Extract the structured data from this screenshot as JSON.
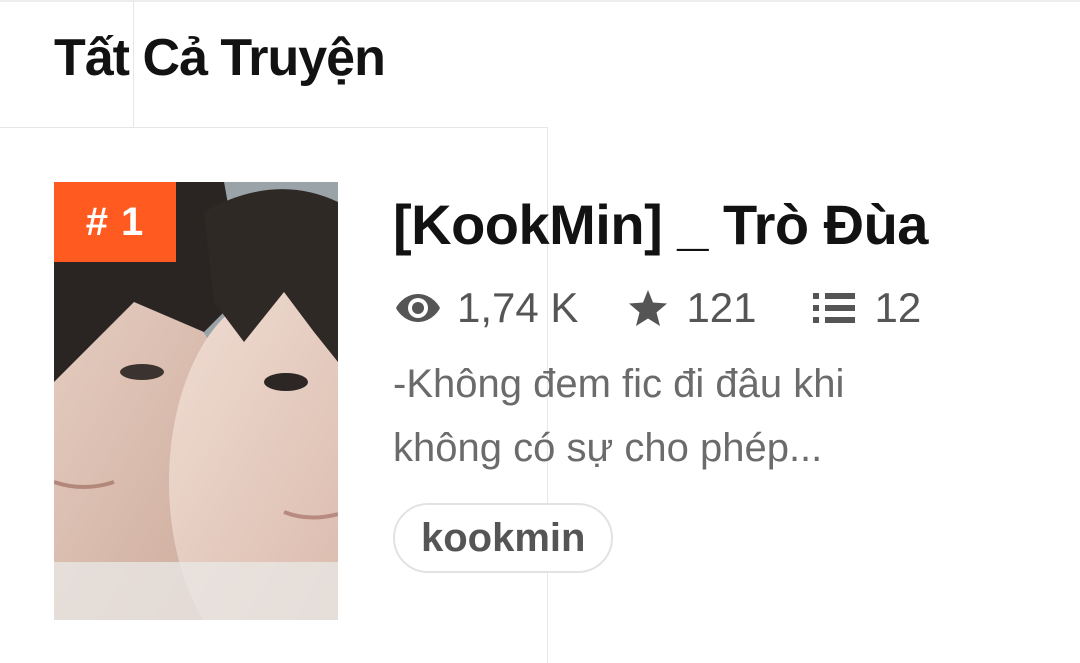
{
  "header": {
    "title": "Tất Cả Truyện"
  },
  "story": {
    "rank": "# 1",
    "title": "[KookMin] _ Trò Đùa",
    "cover_icon": "story-cover-image",
    "stats": {
      "views": "1,74 K",
      "votes": "121",
      "parts": "12",
      "views_icon": "eye-icon",
      "votes_icon": "star-icon",
      "parts_icon": "list-icon"
    },
    "description_line1": "-Không đem fic đi đâu khi",
    "description_line2": "không có sự cho phép...",
    "tags": [
      "kookmin"
    ]
  },
  "colors": {
    "rank_badge": "#ff5a1f",
    "title_text": "#121212",
    "meta_text": "#555555",
    "description_text": "#6b6b6b",
    "tag_border": "#e2e2e2"
  }
}
